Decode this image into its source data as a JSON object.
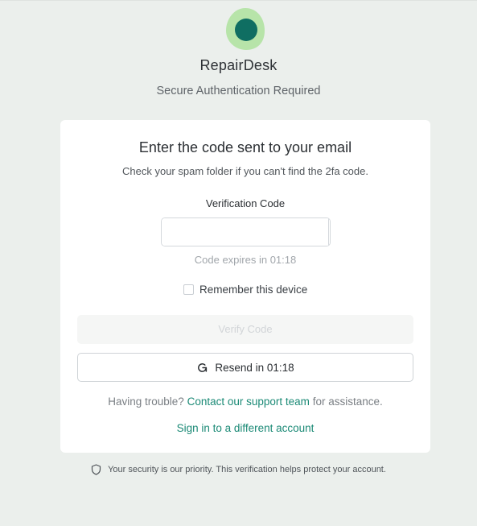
{
  "app": {
    "title": "RepairDesk",
    "subtitle": "Secure Authentication Required",
    "logo_icon": "repairdesk-logo-icon",
    "brand_color": "#1b8a76",
    "logo_outer_color": "#b7e4a9",
    "logo_inner_color": "#0f6e62"
  },
  "card": {
    "title": "Enter the code sent to your email",
    "hint": "Check your spam folder if you can't find the 2fa code.",
    "code_label": "Verification Code",
    "code_digits": [
      "",
      "",
      "",
      "",
      "",
      ""
    ],
    "expiry_text": "Code expires in 01:18",
    "remember_label": "Remember this device",
    "remember_checked": false,
    "verify_label": "Verify Code",
    "resend_label": "Resend in 01:18",
    "resend_icon": "refresh-icon",
    "trouble_prefix": "Having trouble?",
    "trouble_link": "Contact our support team",
    "trouble_suffix": "for assistance.",
    "switch_account_label": "Sign in to a different account"
  },
  "footer": {
    "icon": "shield-icon",
    "text": "Your security is our priority. This verification helps protect your account."
  }
}
